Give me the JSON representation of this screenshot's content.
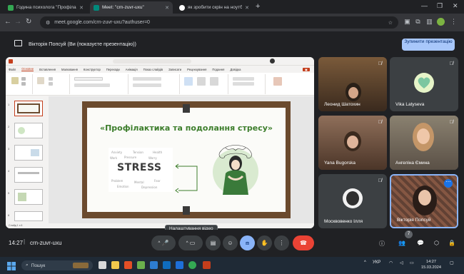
{
  "browser": {
    "tabs": [
      {
        "title": "Година психолога \"Профілактика",
        "active": false
      },
      {
        "title": "Meet: \"crn-zuvr-uxu\"",
        "active": true
      },
      {
        "title": "як зробити скрін на ноутбуці",
        "active": false
      }
    ],
    "url": "meet.google.com/crn-zuvr-uxu?authuser=0"
  },
  "meet": {
    "presenting_text": "Вікторія Попсуй (Ви (показуєте презентацію))",
    "stop_button": "Зупинити презентацію",
    "participants": [
      {
        "name": "Леонид Шатохин"
      },
      {
        "name": "Vika Latyseva"
      },
      {
        "name": "Yana Bugorska"
      },
      {
        "name": "Ангеліна Ємина"
      },
      {
        "name": "Москвовенко Ілля"
      },
      {
        "name": "Вікторія Попсуй"
      }
    ],
    "time": "14:27",
    "meeting_code": "crn-zuvr-uxu",
    "tooltip": "Налаштування відео",
    "participant_count": "7"
  },
  "powerpoint": {
    "menu": [
      "Файл",
      "Основне",
      "Вставлення",
      "Малювання",
      "Конструктор",
      "Переходи",
      "Анімація",
      "Показ слайдів",
      "Записати",
      "Рецензування",
      "Подання",
      "Довідка"
    ],
    "slide_title": "«Профілактика та подолання стресу»",
    "stress_word": "STRESS",
    "slide_numbers": [
      "1",
      "2",
      "3",
      "4",
      "5",
      "6"
    ],
    "status": "Слайд 1 з 6"
  },
  "taskbar": {
    "search_placeholder": "Пошук",
    "lang": "УКР",
    "clock_time": "14:27",
    "clock_date": "15.03.2024"
  },
  "colors": {
    "accent": "#a8c7fa",
    "end_call": "#ea4335",
    "ppt_red": "#c43e1c",
    "slide_green": "#3c7d2b"
  }
}
